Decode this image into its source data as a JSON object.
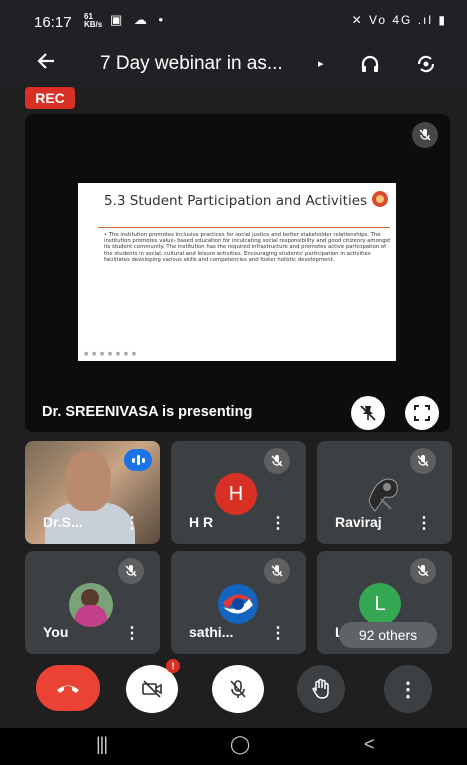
{
  "status_bar": {
    "time": "16:17",
    "data_speed_top": "61",
    "data_speed_bottom": "KB/s",
    "left_icons": "▣ ☁ •",
    "right_icons": "✕ Vo 4G .ıl ▮"
  },
  "header": {
    "back_icon": "arrow-left-icon",
    "title": "7 Day webinar in as...",
    "title_arrow": "▸",
    "audio_icon": "headphones-icon",
    "camera_switch_icon": "camera-switch-icon"
  },
  "recording_badge": "REC",
  "presentation": {
    "slide": {
      "title": "5.3 Student Participation and Activities",
      "body": "• The institution promotes inclusive practices for social justice and better stakeholder relationships. The institution promotes value- based education for inculcating social responsibility and good citizenry amongst its student community. The institution has the required infrastructure and promotes active participation of the students in social, cultural and leisure activities. Encouraging students' participation in activities facilitates developing various skills and competencies and foster holistic development.",
      "page_dots": "● ● ● ● ● ● ●"
    },
    "presenter_text": "Dr. SREENIVASA is presenting"
  },
  "participants": [
    {
      "name": "Dr.S...",
      "type": "video",
      "speaking": true
    },
    {
      "name": "H R",
      "type": "letter",
      "letter": "H",
      "color": "#d93025"
    },
    {
      "name": "Raviraj",
      "type": "image"
    },
    {
      "name": "You",
      "type": "image"
    },
    {
      "name": "sathi...",
      "type": "image"
    },
    {
      "name": "La...",
      "type": "letter",
      "letter": "L",
      "color": "#34a853"
    }
  ],
  "others_count": "92 others",
  "overflow_icon": "⋮",
  "controls": {
    "end_call_color": "#ea4335",
    "camera_badge": "!"
  },
  "navbar": {
    "recents": "|||",
    "home": "◯",
    "back": "<"
  },
  "colors": {
    "background": "#1f1f1f",
    "tile": "#3c4043",
    "rec": "#d93025",
    "accent_blue": "#1a73e8"
  }
}
